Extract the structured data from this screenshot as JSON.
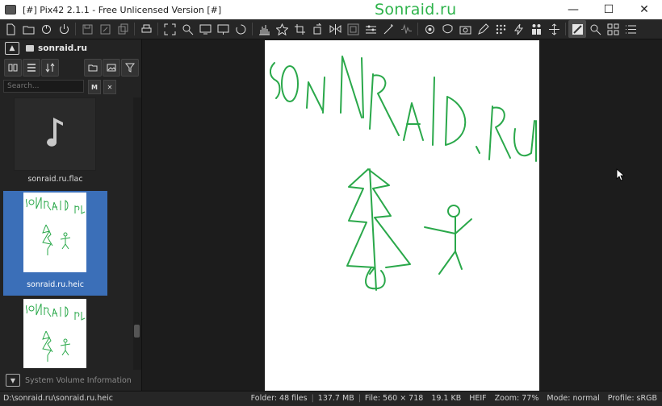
{
  "window": {
    "title": "[#] Pix42 2.1.1 - Free Unlicensed Version [#]",
    "watermark": "Sonraid.ru",
    "minimize": "—",
    "maximize": "☐",
    "close": "✕"
  },
  "toolbar": {
    "icons": [
      "new-file-icon",
      "open-folder-icon",
      "reload-icon",
      "power-icon",
      "save-icon",
      "save-as-icon",
      "copy-icon",
      "print-icon",
      "fit-screen-icon",
      "zoom-icon",
      "screen-icon",
      "monitor-icon",
      "spinner-icon",
      "histogram-icon",
      "star-icon",
      "crop-icon",
      "rotate-icon",
      "flip-icon",
      "resize-icon",
      "adjust-icon",
      "wand-icon",
      "waveform-icon",
      "effects-icon",
      "mask-icon",
      "photo-fix-icon",
      "pencil-icon",
      "grid-dots-icon",
      "lightning-icon",
      "people-icon",
      "move-icon",
      "color-picker-icon",
      "magnifier-icon",
      "thumbnails-icon",
      "list-view-icon"
    ]
  },
  "sidebar": {
    "path_label": "sonraid.ru",
    "search_placeholder": "Search...",
    "search_m": "M",
    "search_x": "✕",
    "items": [
      {
        "caption": "sonraid.ru.flac",
        "type": "audio"
      },
      {
        "caption": "sonraid.ru.heic",
        "type": "image",
        "selected": true
      },
      {
        "caption": "",
        "type": "image"
      }
    ],
    "footer_label": "System Volume Information"
  },
  "drawing": {
    "text": "SONRAID.RU",
    "ink": "#2aa84a"
  },
  "status": {
    "path": "D:\\sonraid.ru\\sonraid.ru.heic",
    "folder": "Folder: 48 files",
    "folder_size": "137.7 MB",
    "file_dims": "File: 560 × 718",
    "file_size": "19.1 KB",
    "format": "HEIF",
    "zoom": "Zoom: 77%",
    "mode": "Mode: normal",
    "profile": "Profile: sRGB"
  },
  "colors": {
    "accent_selected": "#3b6fb8",
    "watermark": "#2db34a"
  }
}
